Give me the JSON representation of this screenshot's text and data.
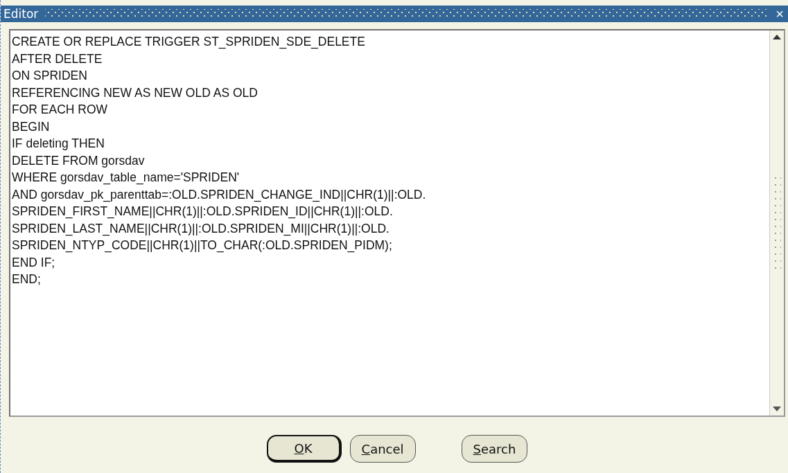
{
  "window": {
    "title": "Editor",
    "close": "×"
  },
  "editor": {
    "lines": [
      "CREATE OR REPLACE TRIGGER ST_SPRIDEN_SDE_DELETE",
      "AFTER DELETE",
      "ON SPRIDEN",
      "REFERENCING NEW AS NEW OLD AS OLD",
      "FOR EACH ROW",
      "BEGIN",
      "IF deleting THEN",
      "DELETE FROM gorsdav",
      "WHERE gorsdav_table_name='SPRIDEN'",
      "AND gorsdav_pk_parenttab=:OLD.SPRIDEN_CHANGE_IND||CHR(1)||:OLD.",
      "SPRIDEN_FIRST_NAME||CHR(1)||:OLD.SPRIDEN_ID||CHR(1)||:OLD.",
      "SPRIDEN_LAST_NAME||CHR(1)||:OLD.SPRIDEN_MI||CHR(1)||:OLD.",
      "SPRIDEN_NTYP_CODE||CHR(1)||TO_CHAR(:OLD.SPRIDEN_PIDM);",
      "END IF;",
      "END;"
    ]
  },
  "buttons": [
    {
      "label": "OK",
      "default": true
    },
    {
      "label": "Cancel",
      "default": false
    },
    {
      "label": "Search",
      "default": false
    }
  ]
}
